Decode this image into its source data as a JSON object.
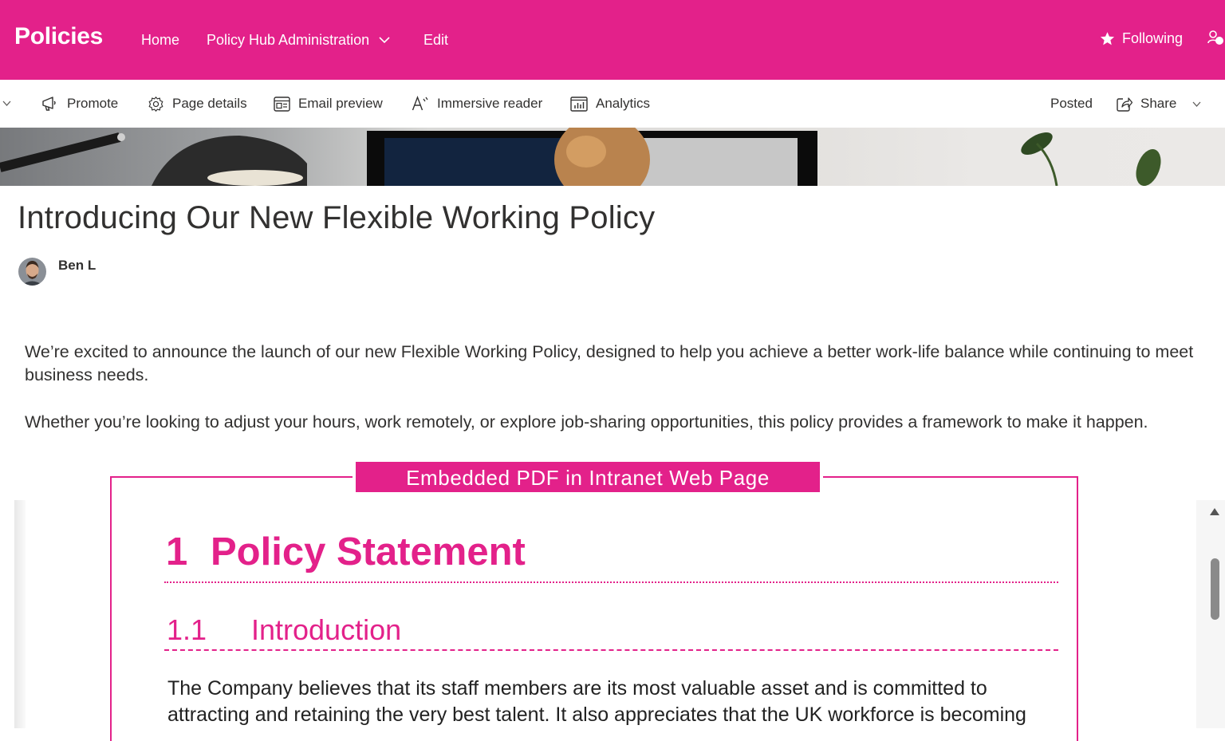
{
  "topbar": {
    "site_title": "Policies",
    "nav": {
      "home": "Home",
      "admin": "Policy Hub Administration",
      "edit": "Edit"
    },
    "following": "Following",
    "accent_color": "#e3218a"
  },
  "commandbar": {
    "promote": "Promote",
    "page_details": "Page details",
    "email_preview": "Email preview",
    "immersive_reader": "Immersive reader",
    "analytics": "Analytics",
    "status": "Posted",
    "share": "Share"
  },
  "article": {
    "title": "Introducing Our New Flexible Working Policy",
    "author": "Ben L",
    "paragraphs": [
      "We’re excited to announce the launch of our new Flexible Working Policy, designed to help you achieve a better work-life balance while continuing to meet business needs.",
      "Whether you’re looking to adjust your hours, work remotely, or explore job-sharing opportunities, this policy provides a framework to make it happen."
    ]
  },
  "annotation": {
    "label": "Embedded PDF in Intranet Web Page"
  },
  "pdf": {
    "heading1_number": "1",
    "heading1_text": "Policy Statement",
    "heading2_number": "1.1",
    "heading2_text": "Introduction",
    "body": "The Company believes that its staff members are its most valuable asset and is committed to attracting and retaining the very best talent. It also appreciates that the UK workforce is becoming"
  }
}
